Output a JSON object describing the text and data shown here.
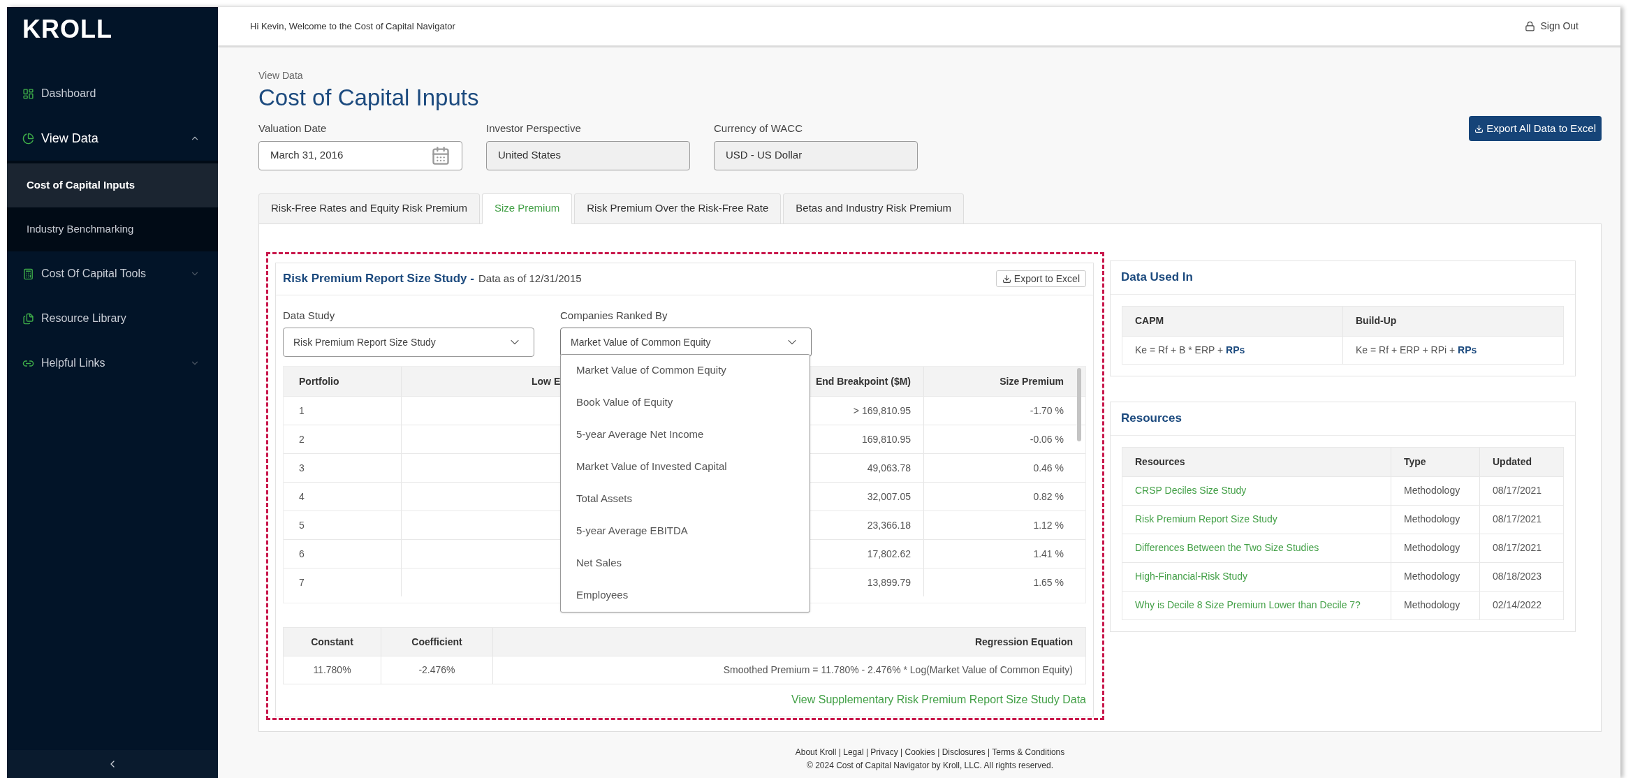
{
  "sidebar": {
    "logo": "KROLL",
    "items": [
      {
        "label": "Dashboard",
        "kind": "link"
      },
      {
        "label": "View Data",
        "kind": "group",
        "expanded": true,
        "children": [
          {
            "label": "Cost of Capital Inputs",
            "selected": true
          },
          {
            "label": "Industry Benchmarking",
            "selected": false
          }
        ]
      },
      {
        "label": "Cost Of Capital Tools",
        "kind": "group",
        "expanded": false
      },
      {
        "label": "Resource Library",
        "kind": "link"
      },
      {
        "label": "Helpful Links",
        "kind": "group",
        "expanded": false
      }
    ]
  },
  "header": {
    "greeting": "Hi Kevin, Welcome to the Cost of Capital Navigator",
    "sign_out": "Sign Out"
  },
  "page": {
    "breadcrumb": "View Data",
    "title": "Cost of Capital Inputs",
    "export_all": "Export All Data to Excel"
  },
  "fields": [
    {
      "label": "Valuation Date",
      "value": "March 31, 2016",
      "kind": "date",
      "disabled": false
    },
    {
      "label": "Investor Perspective",
      "value": "United States",
      "kind": "text",
      "disabled": true
    },
    {
      "label": "Currency of WACC",
      "value": "USD - US Dollar",
      "kind": "text",
      "disabled": true
    }
  ],
  "tabs": [
    {
      "label": "Risk-Free Rates and Equity Risk Premium",
      "selected": false
    },
    {
      "label": "Size Premium",
      "selected": true
    },
    {
      "label": "Risk Premium Over the Risk-Free Rate",
      "selected": false
    },
    {
      "label": "Betas and Industry Risk Premium",
      "selected": false
    }
  ],
  "study": {
    "title": "Risk Premium Report Size Study -",
    "subtitle": "Data as of 12/31/2015",
    "export": "Export to Excel",
    "selects": [
      {
        "label": "Data Study",
        "value": "Risk Premium Report Size Study",
        "expanded": false
      },
      {
        "label": "Companies Ranked By",
        "value": "Market Value of Common Equity",
        "expanded": true,
        "options": [
          "Market Value of Common Equity",
          "Book Value of Equity",
          "5-year Average Net Income",
          "Market Value of Invested Capital",
          "Total Assets",
          "5-year Average EBITDA",
          "Net Sales",
          "Employees"
        ]
      }
    ],
    "table": {
      "columns": [
        "Portfolio",
        "Low E",
        "End Breakpoint ($M)",
        "Size Premium"
      ],
      "rows": [
        {
          "portfolio": "1",
          "end_breakpoint": "> 169,810.95",
          "size_premium": "-1.70 %"
        },
        {
          "portfolio": "2",
          "end_breakpoint": "169,810.95",
          "size_premium": "-0.06 %"
        },
        {
          "portfolio": "3",
          "end_breakpoint": "49,063.78",
          "size_premium": "0.46 %"
        },
        {
          "portfolio": "4",
          "end_breakpoint": "32,007.05",
          "size_premium": "0.82 %"
        },
        {
          "portfolio": "5",
          "end_breakpoint": "23,366.18",
          "size_premium": "1.12 %"
        },
        {
          "portfolio": "6",
          "end_breakpoint": "17,802.62",
          "size_premium": "1.41 %"
        },
        {
          "portfolio": "7",
          "end_breakpoint": "13,899.79",
          "size_premium": "1.65 %"
        }
      ]
    },
    "regression": {
      "columns": [
        "Constant",
        "Coefficient",
        "Regression Equation"
      ],
      "rows": [
        [
          "11.780%",
          "-2.476%",
          "Smoothed Premium = 11.780% - 2.476% * Log(Market Value of Common Equity)"
        ]
      ]
    },
    "link": "View Supplementary Risk Premium Report Size Study Data"
  },
  "data_used_in": {
    "title": "Data Used In",
    "columns": [
      "CAPM",
      "Build-Up"
    ],
    "formulas": [
      {
        "text": "Ke = Rf + B * ERP +",
        "emphasis": "RPs"
      },
      {
        "text": "Ke = Rf + ERP + RPi +",
        "emphasis": "RPs"
      }
    ]
  },
  "resources": {
    "title": "Resources",
    "columns": [
      "Resources",
      "Type",
      "Updated"
    ],
    "rows": [
      [
        "CRSP Deciles Size Study",
        "Methodology",
        "08/17/2021"
      ],
      [
        "Risk Premium Report Size Study",
        "Methodology",
        "08/17/2021"
      ],
      [
        "Differences Between the Two Size Studies",
        "Methodology",
        "08/17/2021"
      ],
      [
        "High-Financial-Risk Study",
        "Methodology",
        "08/18/2023"
      ],
      [
        "Why is Decile 8 Size Premium Lower than Decile 7?",
        "Methodology",
        "02/14/2022"
      ]
    ]
  },
  "footer": {
    "links": "About Kroll | Legal | Privacy | Cookies | Disclosures | Terms & Conditions",
    "copyright": "© 2024 Cost of Capital Navigator by Kroll, LLC. All rights reserved."
  }
}
